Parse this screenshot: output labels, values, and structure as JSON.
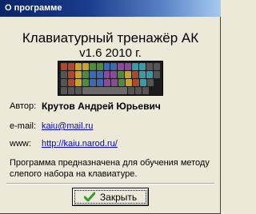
{
  "window": {
    "title": "О программе"
  },
  "app": {
    "name": "Клавиатурный тренажёр АК",
    "version": "v1.6  2010 г."
  },
  "info": {
    "author_label": "Автор:",
    "author_value": "Крутов Андрей Юрьевич",
    "email_label": "e-mail:",
    "email_value": "kaiu@mail.ru",
    "www_label": "www:",
    "www_value": "http://kaiu.narod.ru/"
  },
  "description": "Программа предназначена для обучения методу слепого набора на клавиатуре.",
  "buttons": {
    "close_label": "Закрыть",
    "close_icon": "check-icon"
  },
  "colors": {
    "titlebar": "#0a246a",
    "link": "#0000ee",
    "check": "#2e9e2e"
  }
}
